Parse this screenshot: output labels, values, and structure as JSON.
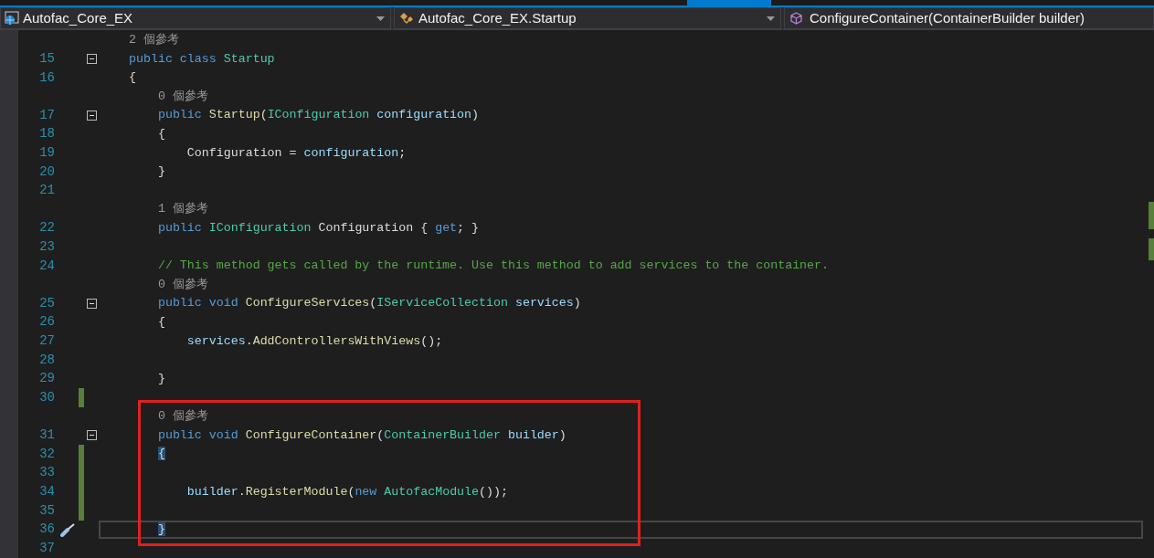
{
  "navigation_bar": {
    "project": {
      "label": "Autofac_Core_EX"
    },
    "class": {
      "label": "Autofac_Core_EX.Startup"
    },
    "member": {
      "label": "ConfigureContainer(ContainerBuilder builder)"
    }
  },
  "editor": {
    "rows": [
      {
        "kind": "lens",
        "text": "2 個參考"
      },
      {
        "kind": "code",
        "number": "15",
        "fold": true,
        "changed": false,
        "current": false,
        "tokens": [
          {
            "kind": "keyword",
            "text": "public class "
          },
          {
            "kind": "type",
            "text": "Startup"
          }
        ]
      },
      {
        "kind": "code",
        "number": "16",
        "fold": false,
        "changed": false,
        "current": false,
        "tokens": [
          {
            "kind": "plain",
            "text": "{"
          }
        ]
      },
      {
        "kind": "lens",
        "text": "    0 個參考"
      },
      {
        "kind": "code",
        "number": "17",
        "fold": true,
        "changed": false,
        "current": false,
        "tokens": [
          {
            "kind": "keyword",
            "text": "    public "
          },
          {
            "kind": "method",
            "text": "Startup"
          },
          {
            "kind": "plain",
            "text": "("
          },
          {
            "kind": "type",
            "text": "IConfiguration "
          },
          {
            "kind": "param",
            "text": "configuration"
          },
          {
            "kind": "plain",
            "text": ")"
          }
        ]
      },
      {
        "kind": "code",
        "number": "18",
        "fold": false,
        "changed": false,
        "current": false,
        "tokens": [
          {
            "kind": "plain",
            "text": "    {"
          }
        ]
      },
      {
        "kind": "code",
        "number": "19",
        "fold": false,
        "changed": false,
        "current": false,
        "tokens": [
          {
            "kind": "plain",
            "text": "        Configuration = "
          },
          {
            "kind": "param",
            "text": "configuration"
          },
          {
            "kind": "plain",
            "text": ";"
          }
        ]
      },
      {
        "kind": "code",
        "number": "20",
        "fold": false,
        "changed": false,
        "current": false,
        "tokens": [
          {
            "kind": "plain",
            "text": "    }"
          }
        ]
      },
      {
        "kind": "code",
        "number": "21",
        "fold": false,
        "changed": false,
        "current": false,
        "tokens": []
      },
      {
        "kind": "lens",
        "text": "    1 個參考"
      },
      {
        "kind": "code",
        "number": "22",
        "fold": false,
        "changed": false,
        "current": false,
        "tokens": [
          {
            "kind": "keyword",
            "text": "    public "
          },
          {
            "kind": "type",
            "text": "IConfiguration"
          },
          {
            "kind": "plain",
            "text": " Configuration { "
          },
          {
            "kind": "keyword",
            "text": "get"
          },
          {
            "kind": "plain",
            "text": "; }"
          }
        ]
      },
      {
        "kind": "code",
        "number": "23",
        "fold": false,
        "changed": false,
        "current": false,
        "tokens": []
      },
      {
        "kind": "code",
        "number": "24",
        "fold": false,
        "changed": false,
        "current": false,
        "tokens": [
          {
            "kind": "comment",
            "text": "    // This method gets called by the runtime. Use this method to add services to the container."
          }
        ]
      },
      {
        "kind": "lens",
        "text": "    0 個參考"
      },
      {
        "kind": "code",
        "number": "25",
        "fold": true,
        "changed": false,
        "current": false,
        "tokens": [
          {
            "kind": "keyword",
            "text": "    public void "
          },
          {
            "kind": "method",
            "text": "ConfigureServices"
          },
          {
            "kind": "plain",
            "text": "("
          },
          {
            "kind": "type",
            "text": "IServiceCollection "
          },
          {
            "kind": "param",
            "text": "services"
          },
          {
            "kind": "plain",
            "text": ")"
          }
        ]
      },
      {
        "kind": "code",
        "number": "26",
        "fold": false,
        "changed": false,
        "current": false,
        "tokens": [
          {
            "kind": "plain",
            "text": "    {"
          }
        ]
      },
      {
        "kind": "code",
        "number": "27",
        "fold": false,
        "changed": false,
        "current": false,
        "tokens": [
          {
            "kind": "param",
            "text": "        services"
          },
          {
            "kind": "plain",
            "text": "."
          },
          {
            "kind": "method",
            "text": "AddControllersWithViews"
          },
          {
            "kind": "plain",
            "text": "();"
          }
        ]
      },
      {
        "kind": "code",
        "number": "28",
        "fold": false,
        "changed": false,
        "current": false,
        "tokens": []
      },
      {
        "kind": "code",
        "number": "29",
        "fold": false,
        "changed": false,
        "current": false,
        "tokens": [
          {
            "kind": "plain",
            "text": "    }"
          }
        ]
      },
      {
        "kind": "code",
        "number": "30",
        "fold": false,
        "changed": true,
        "current": false,
        "tokens": []
      },
      {
        "kind": "lens",
        "text": "    0 個參考"
      },
      {
        "kind": "code",
        "number": "31",
        "fold": true,
        "changed": false,
        "current": false,
        "tokens": [
          {
            "kind": "keyword",
            "text": "    public void "
          },
          {
            "kind": "method",
            "text": "ConfigureContainer"
          },
          {
            "kind": "plain",
            "text": "("
          },
          {
            "kind": "type",
            "text": "ContainerBuilder "
          },
          {
            "kind": "param",
            "text": "builder"
          },
          {
            "kind": "plain",
            "text": ")"
          }
        ]
      },
      {
        "kind": "code",
        "number": "32",
        "fold": false,
        "changed": true,
        "current": false,
        "tokens": [
          {
            "kind": "brace_match",
            "text": "    {"
          }
        ]
      },
      {
        "kind": "code",
        "number": "33",
        "fold": false,
        "changed": true,
        "current": false,
        "tokens": []
      },
      {
        "kind": "code",
        "number": "34",
        "fold": false,
        "changed": true,
        "current": false,
        "tokens": [
          {
            "kind": "param",
            "text": "        builder"
          },
          {
            "kind": "plain",
            "text": "."
          },
          {
            "kind": "method",
            "text": "RegisterModule"
          },
          {
            "kind": "plain",
            "text": "("
          },
          {
            "kind": "keyword",
            "text": "new "
          },
          {
            "kind": "type",
            "text": "AutofacModule"
          },
          {
            "kind": "plain",
            "text": "());"
          }
        ]
      },
      {
        "kind": "code",
        "number": "35",
        "fold": false,
        "changed": true,
        "current": false,
        "tokens": []
      },
      {
        "kind": "code",
        "number": "36",
        "fold": false,
        "changed": false,
        "current": true,
        "tokens": [
          {
            "kind": "brace_match",
            "text": "    }"
          }
        ]
      },
      {
        "kind": "code",
        "number": "37",
        "fold": false,
        "changed": false,
        "current": false,
        "tokens": []
      }
    ]
  }
}
